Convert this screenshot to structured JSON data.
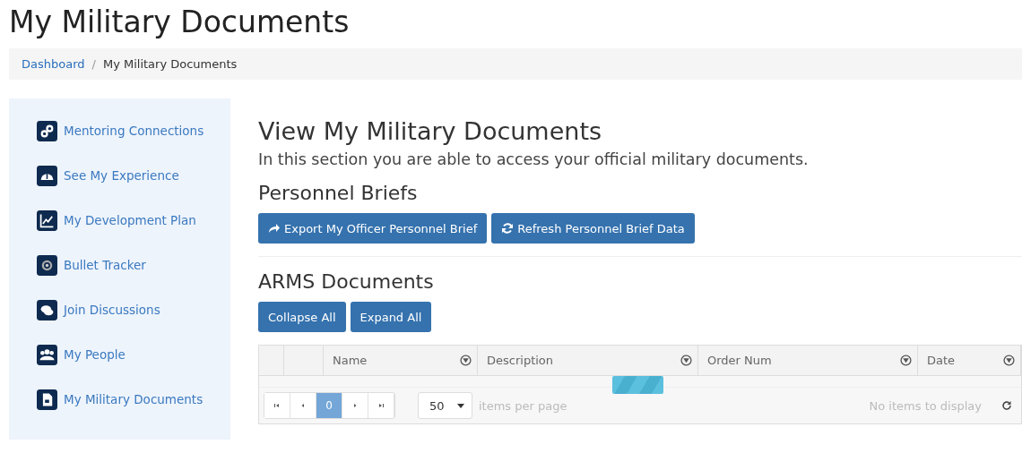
{
  "page_title": "My Military Documents",
  "breadcrumb": {
    "separator": "/",
    "items": [
      {
        "label": "Dashboard",
        "kind": "link"
      },
      {
        "label": "My Military Documents",
        "kind": "current"
      }
    ]
  },
  "sidebar": {
    "items": [
      {
        "label": "Mentoring Connections",
        "kind": "link"
      },
      {
        "label": "See My Experience",
        "kind": "gauge"
      },
      {
        "label": "My Development Plan",
        "kind": "chart"
      },
      {
        "label": "Bullet Tracker",
        "kind": "target"
      },
      {
        "label": "Join Discussions",
        "kind": "chat"
      },
      {
        "label": "My People",
        "kind": "people"
      },
      {
        "label": "My Military Documents",
        "kind": "document"
      }
    ]
  },
  "main": {
    "title": "View My Military Documents",
    "intro": "In this section you are able to access your official military documents.",
    "briefs": {
      "heading": "Personnel Briefs",
      "buttons": [
        {
          "label": "Export My Officer Personnel Brief",
          "kind": "share"
        },
        {
          "label": "Refresh Personnel Brief Data",
          "kind": "refresh"
        }
      ]
    },
    "arms": {
      "heading": "ARMS Documents",
      "buttons": [
        "Collapse All",
        "Expand All"
      ],
      "table": {
        "columns": [
          {
            "kind": "blank"
          },
          {
            "kind": "blank"
          },
          {
            "label": "Name",
            "kind": "filter"
          },
          {
            "label": "Description",
            "kind": "filter"
          },
          {
            "label": "Order Num",
            "kind": "filter"
          },
          {
            "label": "Date",
            "kind": "filter"
          }
        ],
        "pager": {
          "pages": [
            {
              "label": "0",
              "selected": true
            }
          ],
          "page_size": "50",
          "page_size_label": "items per page",
          "status": "No items to display"
        }
      }
    }
  }
}
